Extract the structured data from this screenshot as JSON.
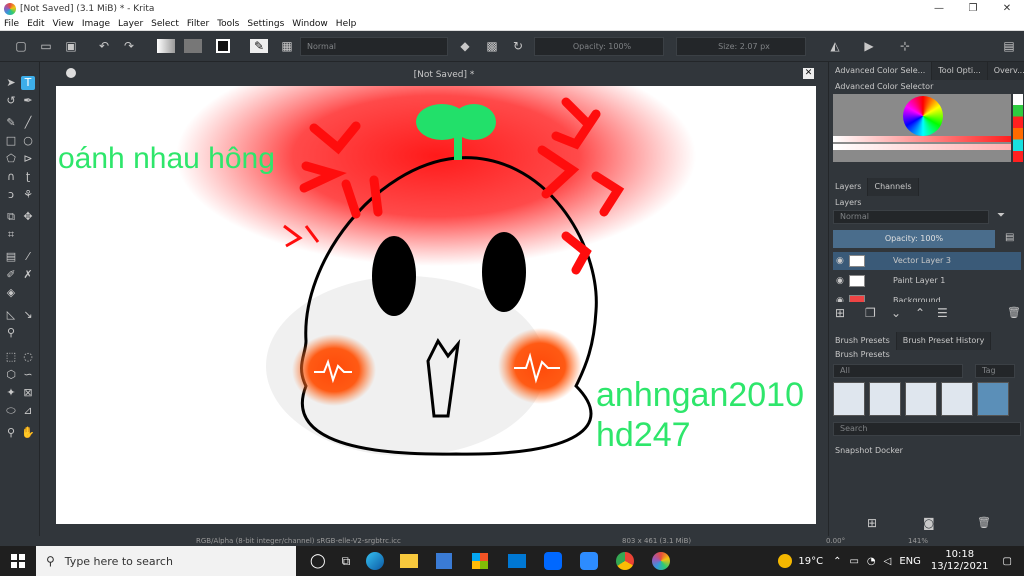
{
  "window": {
    "title": "[Not Saved]  (3.1 MiB)  * - Krita"
  },
  "menu": [
    "File",
    "Edit",
    "View",
    "Image",
    "Layer",
    "Select",
    "Filter",
    "Tools",
    "Settings",
    "Window",
    "Help"
  ],
  "toolbar": {
    "blend_mode": "Normal",
    "opacity": "Opacity: 100%",
    "size": "Size: 2.07 px"
  },
  "document": {
    "tab_title": "[Not Saved]  *",
    "close": "✕"
  },
  "canvas_text": {
    "top_left": "oánh nhau hông",
    "bottom_right_1": "anhngan2010",
    "bottom_right_2": "hd247"
  },
  "statusbar": {
    "colorspace": "RGB/Alpha (8-bit integer/channel)  sRGB-elle-V2-srgbtrc.icc",
    "dimensions": "803 x 461 (3.1 MiB)",
    "rotation": "0.00°",
    "zoom": "141%"
  },
  "docker": {
    "tabs_top": [
      "Advanced Color Sele...",
      "Tool Opti...",
      "Overv..."
    ],
    "adv_color_title": "Advanced Color Selector",
    "tabs_layers": [
      "Layers",
      "Channels"
    ],
    "layers_title": "Layers",
    "blend_mode": "Normal",
    "opacity": "Opacity:  100%",
    "layers": [
      {
        "name": "Vector Layer 3"
      },
      {
        "name": "Paint Layer 1"
      },
      {
        "name": "Background"
      }
    ],
    "tabs_brush": [
      "Brush Presets",
      "Brush Preset History"
    ],
    "brush_title": "Brush Presets",
    "brush_filter": "All",
    "brush_tag": "Tag",
    "search_placeholder": "Search",
    "snapshot_title": "Snapshot Docker"
  },
  "taskbar": {
    "search_placeholder": "Type here to search",
    "weather": "19°C",
    "lang": "ENG",
    "time": "10:18",
    "date": "13/12/2021"
  },
  "colors": {
    "accent": "#3daee9",
    "chrome": "#31363b",
    "text_green": "#2ee66b",
    "red": "#ff1a1a",
    "orange": "#ff5a14"
  }
}
